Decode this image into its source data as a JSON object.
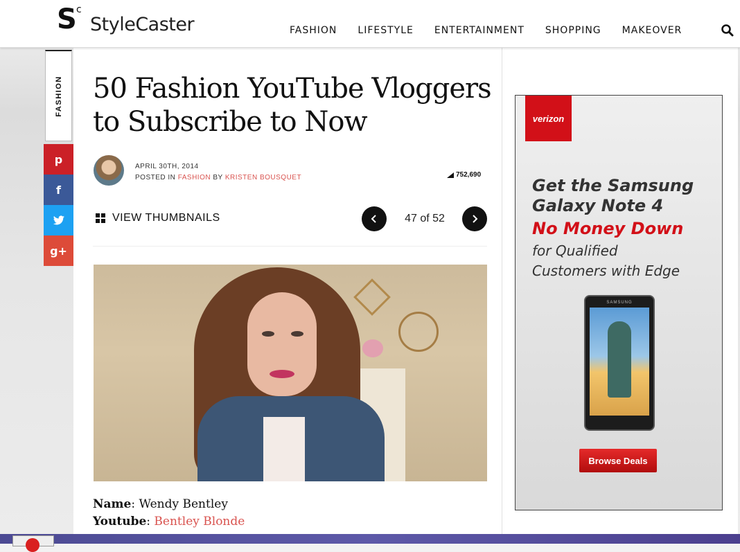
{
  "header": {
    "logo_text": "StyleCaster",
    "logo_mark": "S",
    "logo_mark_sup": "c",
    "nav": [
      "FASHION",
      "LIFESTYLE",
      "ENTERTAINMENT",
      "SHOPPING",
      "MAKEOVER"
    ]
  },
  "rail": {
    "category": "FASHION",
    "share": [
      "p",
      "f",
      "t",
      "g+"
    ]
  },
  "article": {
    "title": "50 Fashion YouTube Vloggers to Subscribe to Now",
    "date": "APRIL 30TH, 2014",
    "posted_in_label": "POSTED IN",
    "category_link": "FASHION",
    "by_label": "BY",
    "author": "KRISTEN BOUSQUET",
    "views": "752,690",
    "view_thumbnails": "VIEW THUMBNAILS",
    "pager": "47 of 52",
    "name_label": "Name",
    "name_value": "Wendy Bentley",
    "youtube_label": "Youtube",
    "youtube_value": "Bentley Blonde"
  },
  "ad": {
    "brand": "verizon",
    "line1": "Get the Samsung",
    "line2": "Galaxy Note 4",
    "line3": "No Money Down",
    "line4": "for Qualified",
    "line5": "Customers with Edge",
    "phone_brand": "SAMSUNG",
    "cta": "Browse Deals"
  },
  "colors": {
    "accent_link": "#d9534f",
    "pinterest": "#cb2027",
    "facebook": "#3b5998",
    "twitter": "#1da1f2",
    "google_plus": "#dd4b39",
    "verizon_red": "#d21018"
  }
}
